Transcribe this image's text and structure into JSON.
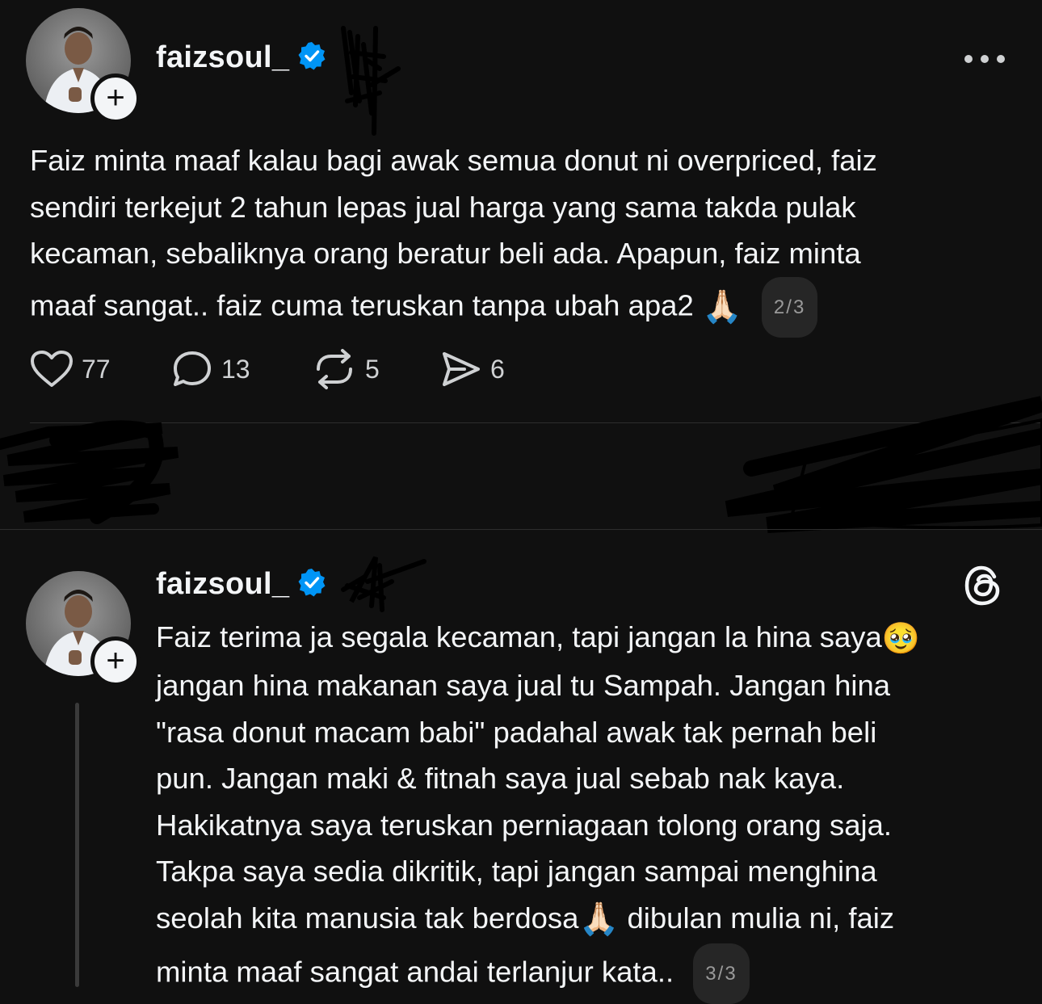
{
  "post1": {
    "username": "faizsoul_",
    "verified_icon": "verified-badge-icon",
    "more_icon": "more-dots-icon",
    "text": "Faiz minta maaf kalau bagi awak semua donut ni overpriced, faiz sendiri terkejut 2 tahun lepas jual harga yang sama takda pulak kecaman, sebaliknya orang beratur beli ada. Apapun, faiz minta maaf sangat.. faiz cuma teruskan tanpa ubah apa2",
    "text_lines": [
      "Faiz minta maaf kalau bagi awak semua donut ni overpriced, faiz",
      "sendiri terkejut 2 tahun lepas jual harga yang sama takda pulak",
      "kecaman, sebaliknya orang beratur beli ada. Apapun, faiz minta",
      "maaf sangat.. faiz cuma teruskan tanpa ubah apa2"
    ],
    "emoji": "🙏🏻",
    "page_indicator": "2/3",
    "actions": {
      "likes": "77",
      "replies": "13",
      "reposts": "5",
      "shares": "6"
    }
  },
  "post2": {
    "username": "faizsoul_",
    "verified_icon": "verified-badge-icon",
    "app_icon": "threads-logo-icon",
    "text_lines": [
      "Faiz terima ja segala kecaman, tapi jangan la hina saya",
      "jangan hina makanan saya jual tu Sampah. Jangan hina",
      "\"rasa donut macam babi\" padahal awak tak pernah beli",
      "pun. Jangan maki & fitnah saya jual sebab nak kaya.",
      "Hakikatnya saya teruskan perniagaan tolong orang saja.",
      "Takpa saya sedia dikritik, tapi jangan sampai menghina",
      "seolah kita manusia tak berdosa",
      "dibulan mulia ni, faiz",
      "minta maaf sangat andai terlanjur kata.."
    ],
    "emoji_pleading": "🥹",
    "emoji_pray": "🙏🏻",
    "page_indicator": "3/3"
  },
  "colors": {
    "background": "#101010",
    "text": "#f3f5f7",
    "secondary_text": "#9a9a9a",
    "verified": "#0095f6",
    "divider": "#2d2d2d"
  }
}
